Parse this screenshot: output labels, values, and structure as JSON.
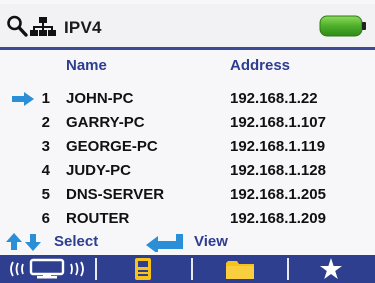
{
  "header": {
    "search_icon": "search-icon",
    "network_icon": "network-icon",
    "title": "IPV4",
    "battery_level_fraction": 1.0,
    "battery_color": "#4caf2a"
  },
  "table": {
    "columns": {
      "name": "Name",
      "address": "Address"
    },
    "rows": [
      {
        "index": "1",
        "name": "JOHN-PC",
        "address": "192.168.1.22",
        "selected": true
      },
      {
        "index": "2",
        "name": "GARRY-PC",
        "address": "192.168.1.107",
        "selected": false
      },
      {
        "index": "3",
        "name": "GEORGE-PC",
        "address": "192.168.1.119",
        "selected": false
      },
      {
        "index": "4",
        "name": "JUDY-PC",
        "address": "192.168.1.128",
        "selected": false
      },
      {
        "index": "5",
        "name": "DNS-SERVER",
        "address": "192.168.1.205",
        "selected": false
      },
      {
        "index": "6",
        "name": "ROUTER",
        "address": "192.168.1.209",
        "selected": false
      }
    ]
  },
  "hints": {
    "select_label": "Select",
    "view_label": "View"
  },
  "softkeys": [
    {
      "icon": "wireless-monitor-icon"
    },
    {
      "icon": "device-save-icon"
    },
    {
      "icon": "folder-icon"
    },
    {
      "icon": "star-icon"
    }
  ],
  "colors": {
    "accent_blue": "#2d3d92",
    "arrow_blue": "#2a8fd6",
    "softkey_bar": "#2e3f90",
    "folder_yellow": "#f7c21a"
  }
}
